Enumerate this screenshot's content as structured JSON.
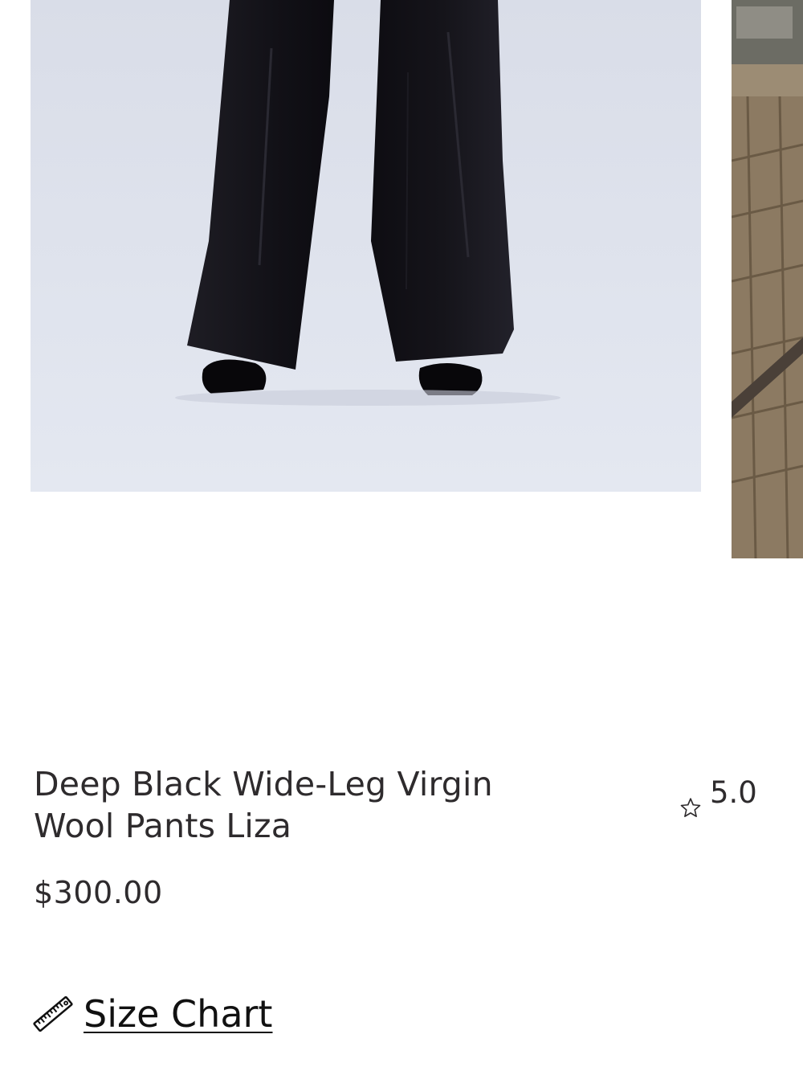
{
  "gallery": {
    "main_image_alt": "product-photo",
    "next_image_alt": "lifestyle-photo"
  },
  "product": {
    "title": "Deep Black Wide-Leg Virgin Wool Pants Liza",
    "rating": "5.0",
    "price": "$300.00"
  },
  "size_chart": {
    "label": "Size Chart",
    "icon": "ruler-icon"
  },
  "colors": {
    "text": "#2e2b2d",
    "link": "#111111",
    "photo_background": "#dfe3ed",
    "pants": "#15141a"
  }
}
